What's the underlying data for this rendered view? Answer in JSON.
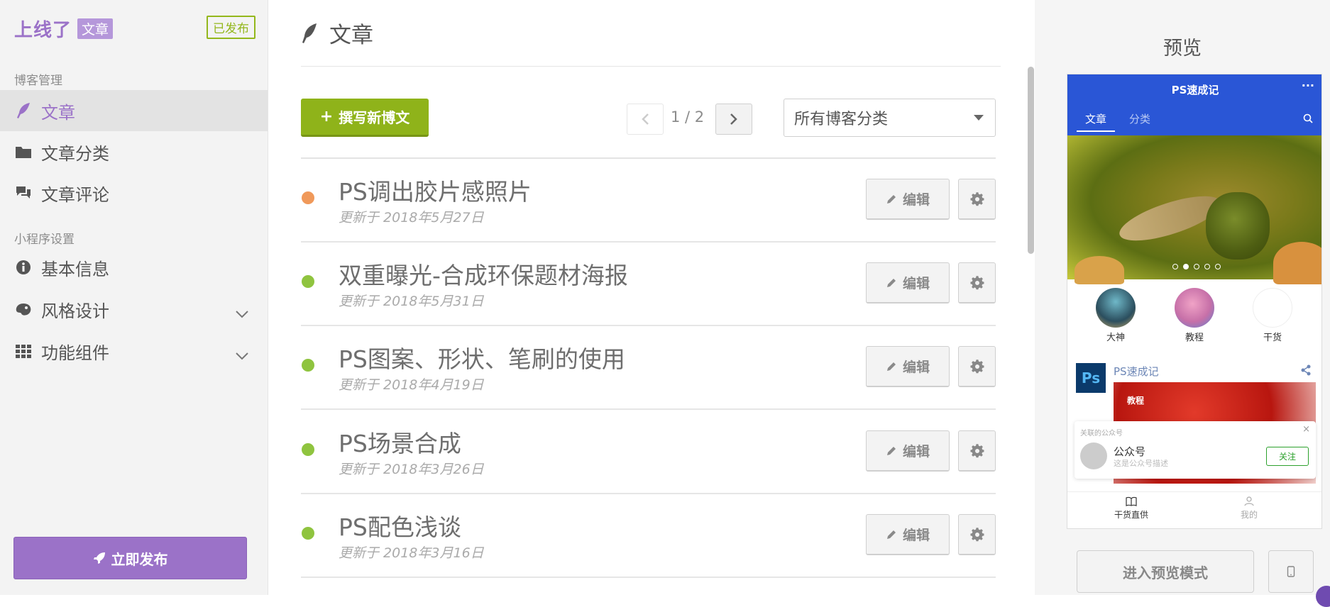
{
  "sidebar": {
    "brand_name": "上线了",
    "brand_tag": "文章",
    "status": "已发布",
    "section_blog": "博客管理",
    "section_mini": "小程序设置",
    "items": [
      {
        "label": "文章"
      },
      {
        "label": "文章分类"
      },
      {
        "label": "文章评论"
      },
      {
        "label": "基本信息"
      },
      {
        "label": "风格设计"
      },
      {
        "label": "功能组件"
      }
    ],
    "publish_label": "立即发布"
  },
  "main": {
    "title": "文章",
    "new_post_label": "撰写新博文",
    "pager": "1 / 2",
    "category_select": "所有博客分类",
    "edit_label": "编辑",
    "posts": [
      {
        "title": "PS调出胶片感照片",
        "date": "更新于 2018年5月27日",
        "status_color": "#f0995a"
      },
      {
        "title": "双重曝光-合成环保题材海报",
        "date": "更新于 2018年5月31日",
        "status_color": "#8fc43f"
      },
      {
        "title": "PS图案、形状、笔刷的使用",
        "date": "更新于 2018年4月19日",
        "status_color": "#8fc43f"
      },
      {
        "title": "PS场景合成",
        "date": "更新于 2018年3月26日",
        "status_color": "#8fc43f"
      },
      {
        "title": "PS配色浅谈",
        "date": "更新于 2018年3月16日",
        "status_color": "#8fc43f"
      }
    ]
  },
  "preview": {
    "title": "预览",
    "phone": {
      "app_name": "PS速成记",
      "more": "···",
      "tabs": [
        "文章",
        "分类"
      ],
      "categories": [
        "大神",
        "教程",
        "干货"
      ],
      "feed_logo": "Ps",
      "feed_name": "PS速成记",
      "feed_tag": "教程",
      "follow": {
        "hint": "关联的公众号",
        "close": "×",
        "title": "公众号",
        "desc": "这是公众号描述",
        "button": "关注"
      },
      "tabbar": [
        "干货直供",
        "我的"
      ]
    },
    "preview_mode_label": "进入预览模式"
  },
  "colors": {
    "accent_purple": "#9b72c8",
    "green": "#8fb31a",
    "phone_blue": "#2a56d6"
  }
}
